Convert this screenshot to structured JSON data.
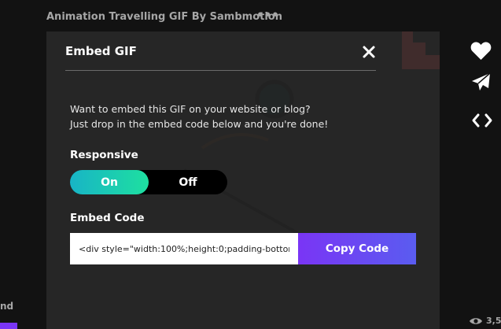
{
  "gif": {
    "title": "Animation Travelling GIF By Sambmotion",
    "more_label": "•••"
  },
  "modal": {
    "title": "Embed GIF",
    "intro_line_1": "Want to embed this GIF on your website or blog?",
    "intro_line_2": "Just drop in the embed code below and you're done!",
    "responsive_label": "Responsive",
    "toggle_on": "On",
    "toggle_off": "Off",
    "toggle_selected": "On",
    "embed_label": "Embed Code",
    "embed_value": "<div style=\"width:100%;height:0;padding-bottom",
    "copy_label": "Copy Code"
  },
  "side": {
    "left_snippet": "nd",
    "views_count": "3,5"
  },
  "colors": {
    "accent_purple": "#7a35f5",
    "toggle_on_start": "#18b4c6",
    "toggle_on_end": "#1ee0a0",
    "corner_red": "#ff5f5f"
  },
  "icons": {
    "close": "close-icon",
    "heart": "heart-icon",
    "send": "paper-plane-icon",
    "embed": "code-brackets-icon",
    "eye": "eye-icon"
  }
}
